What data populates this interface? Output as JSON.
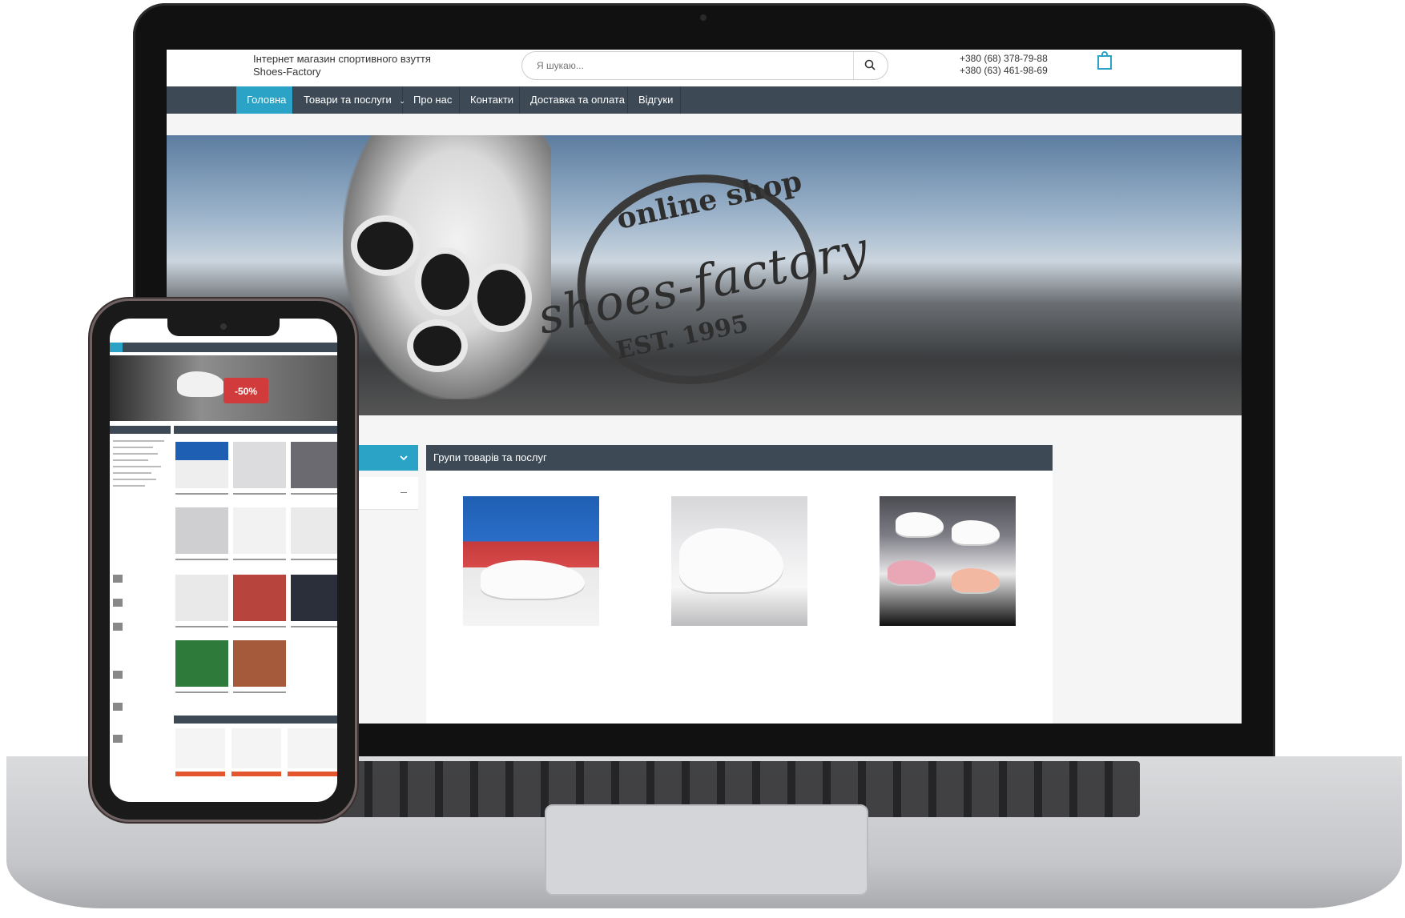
{
  "site": {
    "title_line1": "Інтернет магазин спортивного взуття",
    "title_line2": "Shoes-Factory",
    "search_placeholder": "Я шукаю...",
    "phones": [
      "+380 (68) 378-79-88",
      "+380 (63) 461-98-69"
    ]
  },
  "nav": {
    "items": [
      {
        "label": "Головна",
        "active": true
      },
      {
        "label": "Товари та послуги",
        "has_dropdown": true
      },
      {
        "label": "Про нас"
      },
      {
        "label": "Контакти"
      },
      {
        "label": "Доставка та оплата"
      },
      {
        "label": "Відгуки"
      }
    ]
  },
  "hero": {
    "stamp_top": "online shop",
    "stamp_middle": "shoes-factory",
    "stamp_bottom": "EST. 1995"
  },
  "groups": {
    "title": "Групи товарів та послуг"
  },
  "mobile": {
    "hero_badge": "-50%"
  },
  "colors": {
    "nav_bg": "#3d4a56",
    "accent": "#2aa3c6",
    "sale": "#d23b3b"
  },
  "icons": [
    "search-icon",
    "cart-icon",
    "chevron-down-icon",
    "minus-icon"
  ]
}
